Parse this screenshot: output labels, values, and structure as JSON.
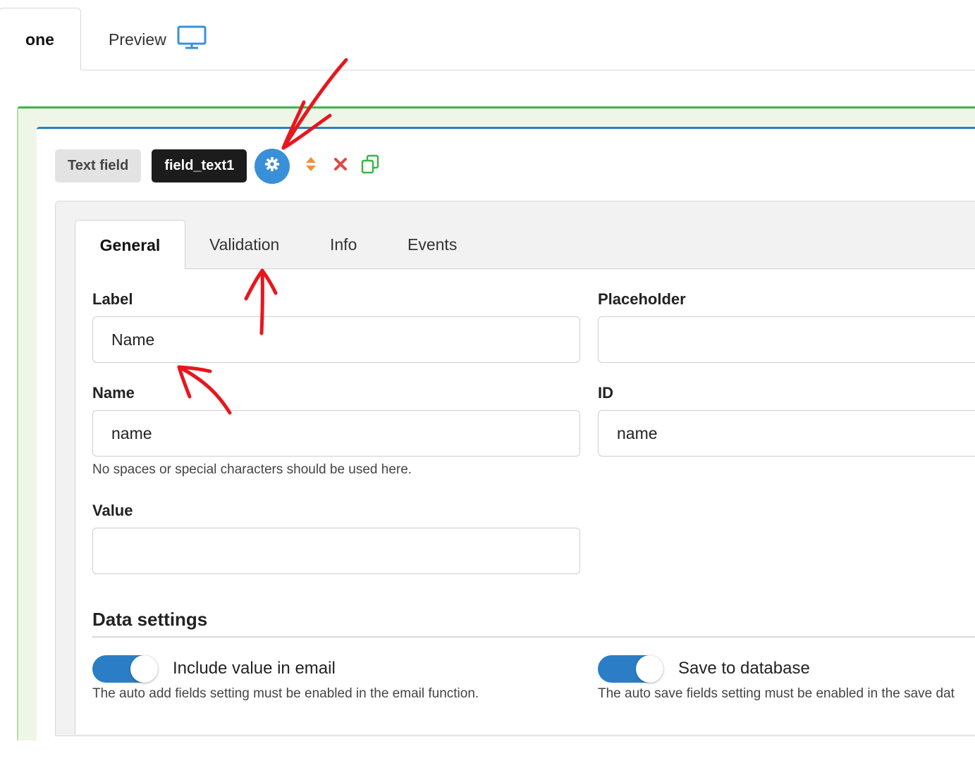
{
  "top_tabs": {
    "active_label": "one",
    "preview_label": "Preview",
    "preview_icon": "monitor-icon"
  },
  "toolbar": {
    "type_badge": "Text field",
    "name_badge": "field_text1",
    "icons": [
      "gear-icon",
      "sort-icon",
      "delete-icon",
      "copy-icon"
    ]
  },
  "settings": {
    "tabs": [
      "General",
      "Validation",
      "Info",
      "Events"
    ],
    "active_tab": "General",
    "fields": {
      "label": {
        "label": "Label",
        "value": "Name"
      },
      "placeholder": {
        "label": "Placeholder",
        "value": ""
      },
      "name": {
        "label": "Name",
        "value": "name",
        "help": "No spaces or special characters should be used here."
      },
      "id": {
        "label": "ID",
        "value": "name"
      },
      "value": {
        "label": "Value",
        "value": ""
      }
    },
    "data_settings": {
      "title": "Data settings",
      "include_email": {
        "label": "Include value in email",
        "enabled": true,
        "help": "The auto add fields setting must be enabled in the email function."
      },
      "save_db": {
        "label": "Save to database",
        "enabled": true,
        "help": "The auto save fields setting must be enabled in the save dat"
      }
    }
  },
  "colors": {
    "accent": "#2b7ec5",
    "green_border": "#3bb54a",
    "annotation": "#e8161e"
  }
}
